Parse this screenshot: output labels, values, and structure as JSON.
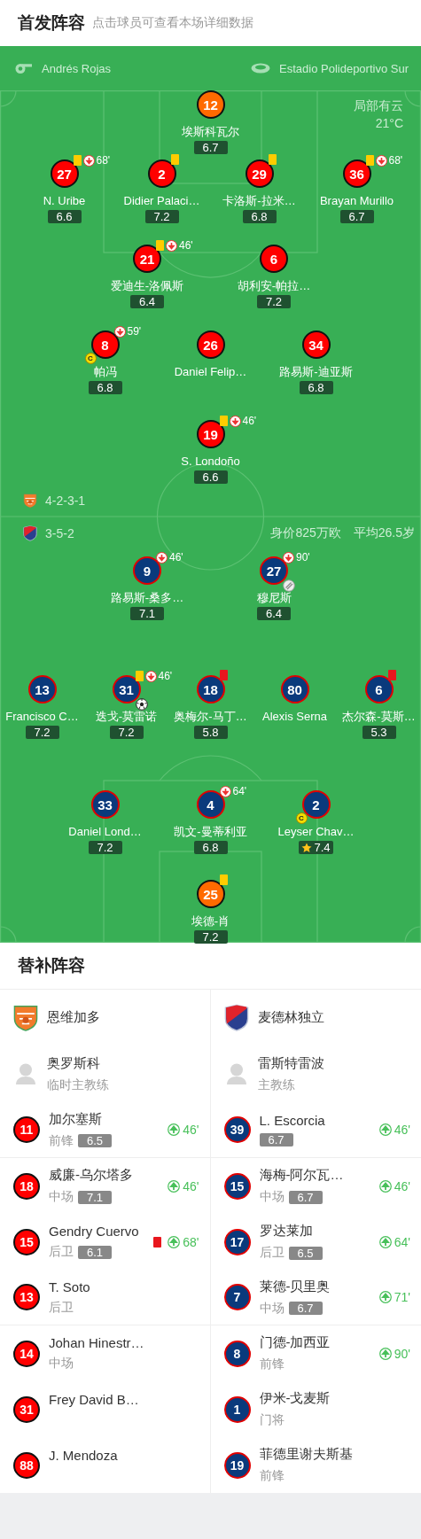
{
  "header": {
    "title": "首发阵容",
    "subtitle": "点击球员可查看本场详细数据"
  },
  "match_info": {
    "referee": "Andrés Rojas",
    "stadium": "Estadio Polideportivo Sur",
    "weather": "局部有云",
    "temperature": "21°C"
  },
  "home": {
    "formation": "4-2-3-1",
    "lines": [
      [
        {
          "number": "12",
          "name": "埃斯科瓦尔",
          "rating": "6.7",
          "kind": "goalkeeper"
        }
      ],
      [
        {
          "number": "27",
          "name": "N. Uribe",
          "rating": "6.6",
          "kind": "outfield",
          "yellow_card": true,
          "sub_out": "68'"
        },
        {
          "number": "2",
          "name": "Didier Palaci…",
          "rating": "7.2",
          "kind": "outfield",
          "yellow_card": true
        },
        {
          "number": "29",
          "name": "卡洛斯-拉米…",
          "rating": "6.8",
          "kind": "outfield",
          "yellow_card": true
        },
        {
          "number": "36",
          "name": "Brayan Murillo",
          "rating": "6.7",
          "kind": "outfield",
          "yellow_card": true,
          "sub_out": "68'"
        }
      ],
      [
        {
          "number": "21",
          "name": "爱迪生-洛佩斯",
          "rating": "6.4",
          "kind": "outfield",
          "yellow_card": true,
          "sub_out": "46'"
        },
        {
          "number": "6",
          "name": "胡利安-帕拉…",
          "rating": "7.2",
          "kind": "outfield"
        }
      ],
      [
        {
          "number": "8",
          "name": "帕冯",
          "rating": "6.8",
          "kind": "outfield",
          "sub_out": "59'",
          "captain": "C"
        },
        {
          "number": "26",
          "name": "Daniel Felip…",
          "kind": "outfield"
        },
        {
          "number": "34",
          "name": "路易斯-迪亚斯",
          "rating": "6.8",
          "kind": "outfield"
        }
      ],
      [
        {
          "number": "19",
          "name": "S. Londoño",
          "rating": "6.6",
          "kind": "outfield",
          "yellow_card": true,
          "sub_out": "46'"
        }
      ]
    ]
  },
  "away": {
    "formation": "3-5-2",
    "market_value": "身价825万欧",
    "average_age": "平均26.5岁",
    "lines": [
      [
        {
          "number": "9",
          "name": "路易斯-桑多…",
          "rating": "7.1",
          "kind": "outfield",
          "sub_out": "46'"
        },
        {
          "number": "27",
          "name": "穆尼斯",
          "rating": "6.4",
          "kind": "outfield",
          "sub_out": "90'",
          "injured": true
        }
      ],
      [
        {
          "number": "13",
          "name": "Francisco C…",
          "rating": "7.2",
          "kind": "outfield"
        },
        {
          "number": "31",
          "name": "迭戈-莫雷诺",
          "rating": "7.2",
          "kind": "outfield",
          "yellow_card": true,
          "sub_out": "46'",
          "goal": true
        },
        {
          "number": "18",
          "name": "奥梅尔-马丁…",
          "rating": "5.8",
          "kind": "outfield",
          "red_card": true
        },
        {
          "number": "80",
          "name": "Alexis Serna",
          "kind": "outfield"
        },
        {
          "number": "6",
          "name": "杰尔森-莫斯…",
          "rating": "5.3",
          "kind": "outfield",
          "red_card": true
        }
      ],
      [
        {
          "number": "33",
          "name": "Daniel Lond…",
          "rating": "7.2",
          "kind": "outfield"
        },
        {
          "number": "4",
          "name": "凯文-曼蒂利亚",
          "rating": "6.8",
          "kind": "outfield",
          "sub_out": "64'"
        },
        {
          "number": "2",
          "name": "Leyser Chav…",
          "rating": "7.4",
          "kind": "outfield",
          "captain": "C",
          "best": true
        }
      ],
      [
        {
          "number": "25",
          "name": "埃德-肖",
          "rating": "7.2",
          "kind": "goalkeeper",
          "yellow_card": true
        }
      ]
    ]
  },
  "substitutes": {
    "title": "替补阵容",
    "teams": [
      {
        "name": "恩维加多",
        "coach": {
          "name": "奥罗斯科",
          "role": "临时主教练"
        },
        "players": [
          {
            "number": "11",
            "name": "加尔塞斯",
            "position": "前锋",
            "rating": "6.5",
            "sub_in": "46'"
          },
          {
            "number": "18",
            "name": "威廉-乌尔塔多",
            "position": "中场",
            "rating": "7.1",
            "sub_in": "46'"
          },
          {
            "number": "15",
            "name": "Gendry Cuervo",
            "position": "后卫",
            "rating": "6.1",
            "sub_in": "68'",
            "red_card": true
          },
          {
            "number": "13",
            "name": "T. Soto",
            "position": "后卫"
          },
          {
            "number": "14",
            "name": "Johan Hinestr…",
            "position": "中场"
          },
          {
            "number": "31",
            "name": "Frey David B…"
          },
          {
            "number": "88",
            "name": "J. Mendoza"
          }
        ]
      },
      {
        "name": "麦德林独立",
        "coach": {
          "name": "雷斯特雷波",
          "role": "主教练"
        },
        "players": [
          {
            "number": "39",
            "name": "L. Escorcia",
            "rating": "6.7",
            "sub_in": "46'"
          },
          {
            "number": "15",
            "name": "海梅-阿尔瓦…",
            "position": "中场",
            "rating": "6.7",
            "sub_in": "46'"
          },
          {
            "number": "17",
            "name": "罗达莱加",
            "position": "后卫",
            "rating": "6.5",
            "sub_in": "64'"
          },
          {
            "number": "7",
            "name": "莱德-贝里奥",
            "position": "中场",
            "rating": "6.7",
            "sub_in": "71'"
          },
          {
            "number": "8",
            "name": "门德-加西亚",
            "position": "前锋",
            "sub_in": "90'"
          },
          {
            "number": "1",
            "name": "伊米-戈麦斯",
            "position": "门将"
          },
          {
            "number": "19",
            "name": "菲德里谢夫斯基",
            "position": "前锋"
          }
        ]
      }
    ]
  }
}
